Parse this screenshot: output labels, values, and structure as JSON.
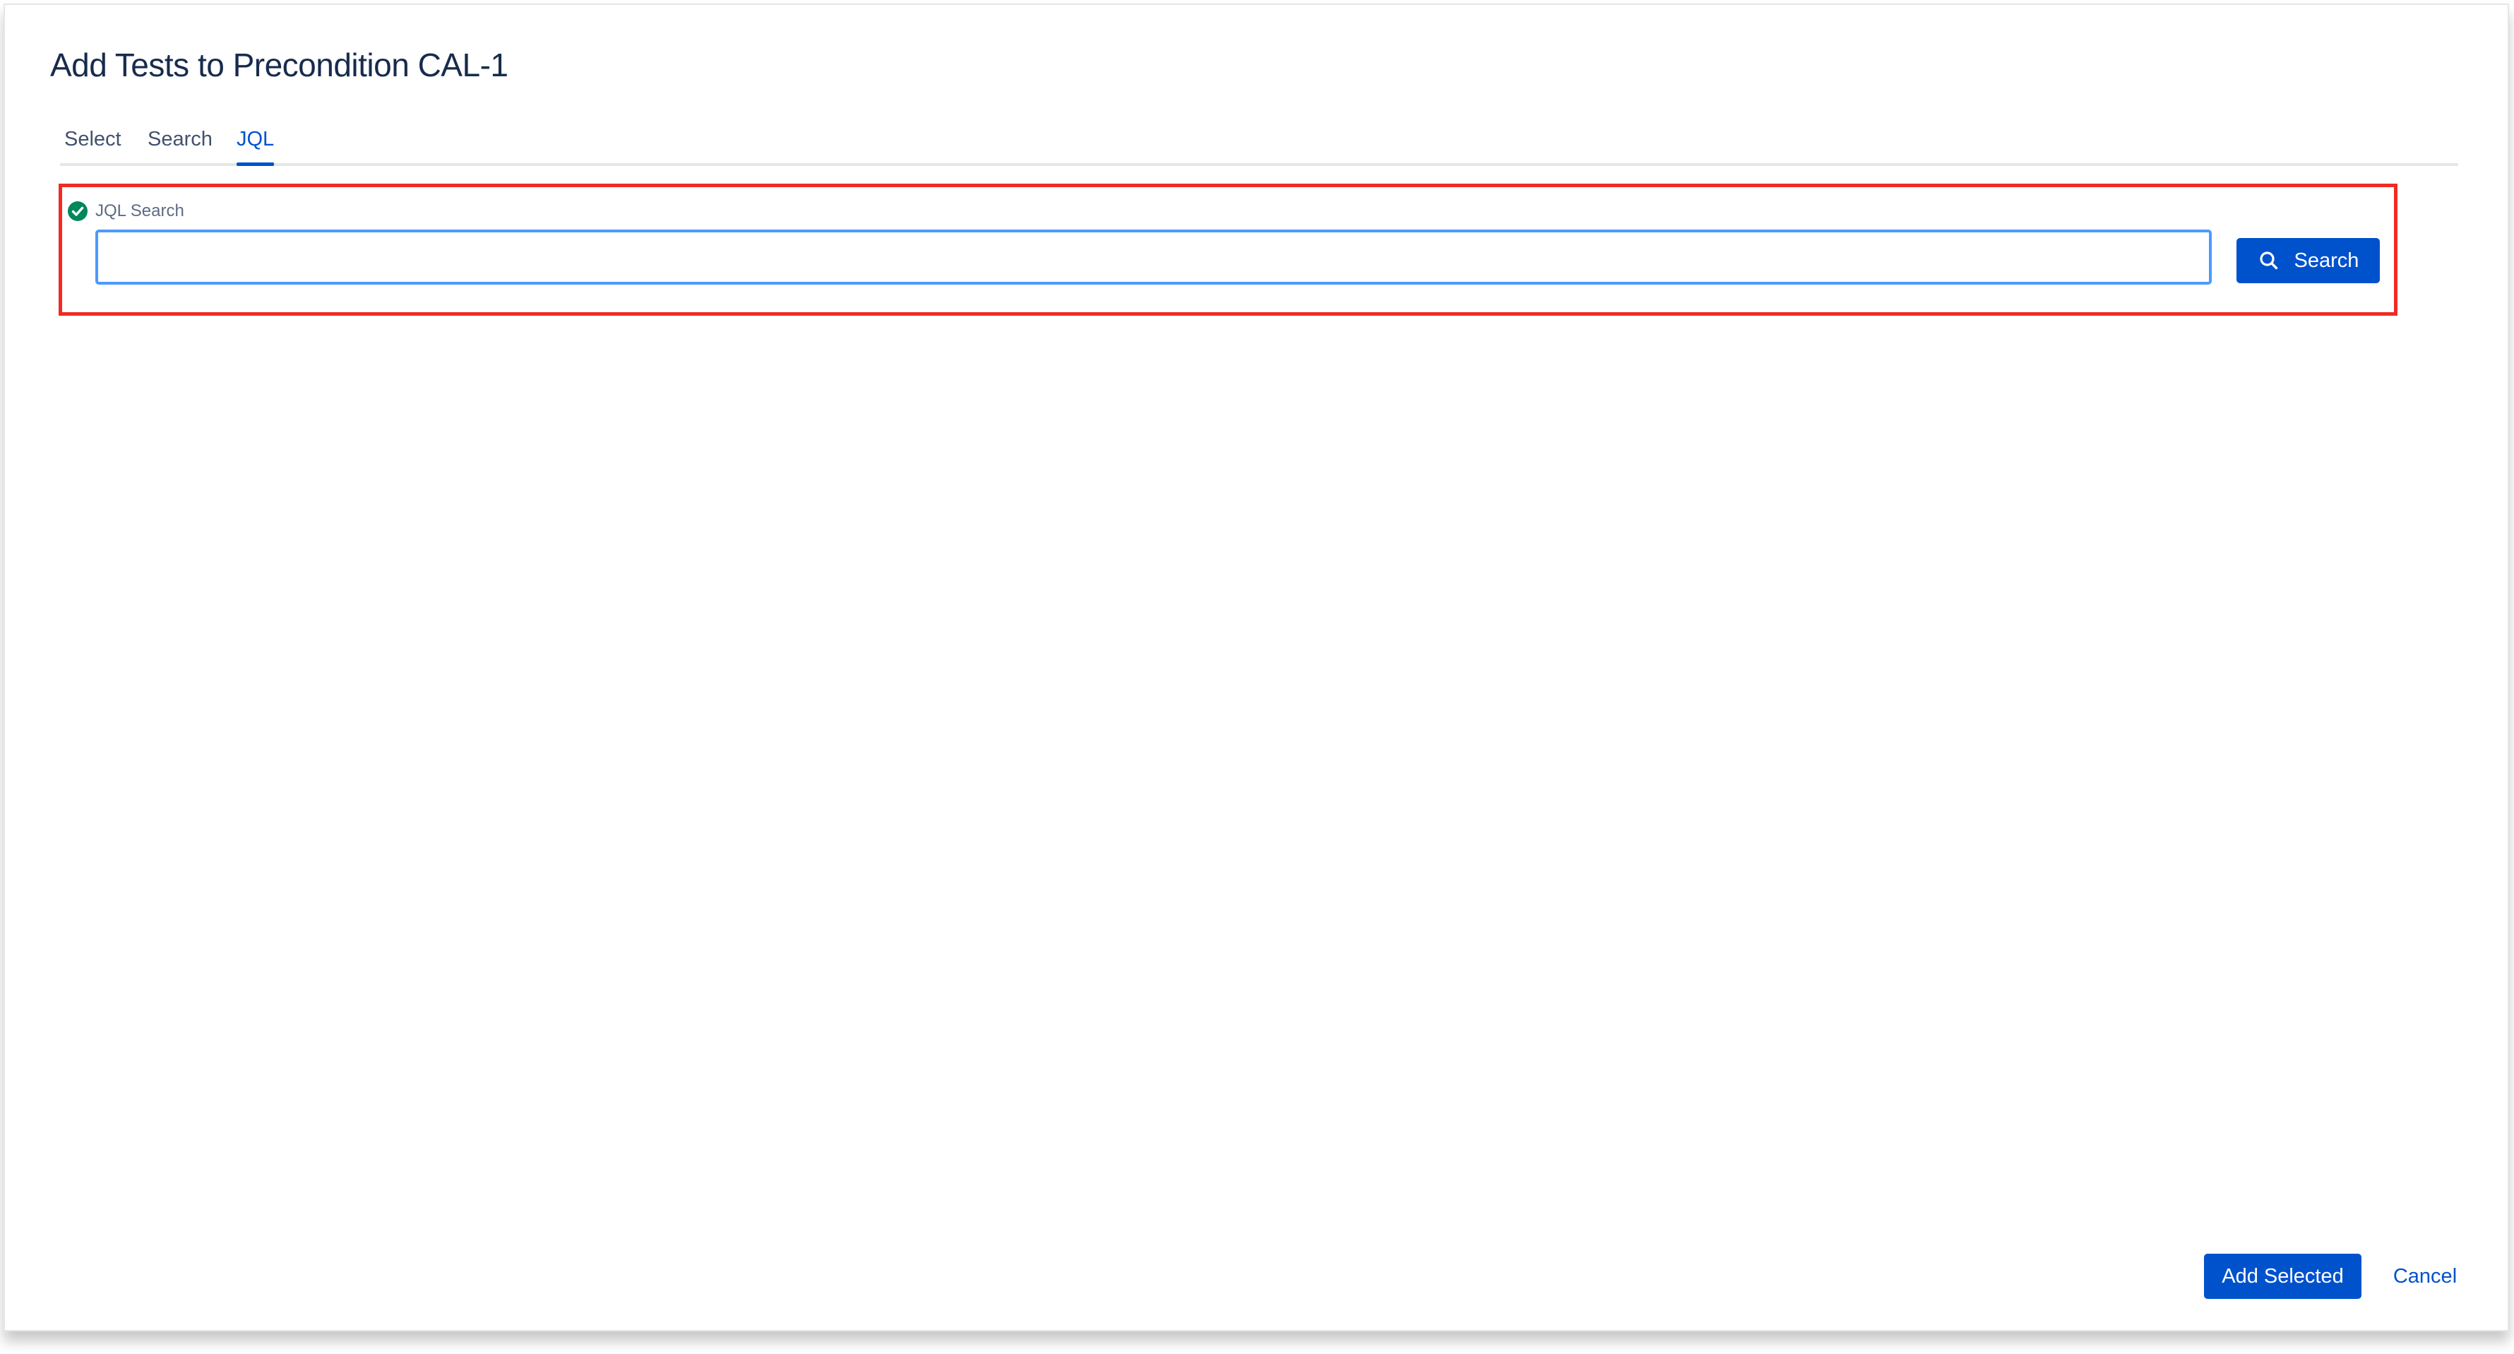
{
  "dialog": {
    "title": "Add Tests to Precondition CAL-1"
  },
  "tabs": [
    {
      "label": "Select",
      "active": false
    },
    {
      "label": "Search",
      "active": false
    },
    {
      "label": "JQL",
      "active": true
    }
  ],
  "jql": {
    "label": "JQL Search",
    "value": "",
    "placeholder": "",
    "status_icon": "check-circle-icon",
    "status_color": "#00875a"
  },
  "search_button": {
    "label": "Search",
    "icon": "search-icon"
  },
  "footer": {
    "add_selected_label": "Add Selected",
    "cancel_label": "Cancel"
  },
  "colors": {
    "primary": "#0052cc",
    "highlight": "#ee2b24",
    "focus": "#4c9aff",
    "title": "#172b4d"
  }
}
